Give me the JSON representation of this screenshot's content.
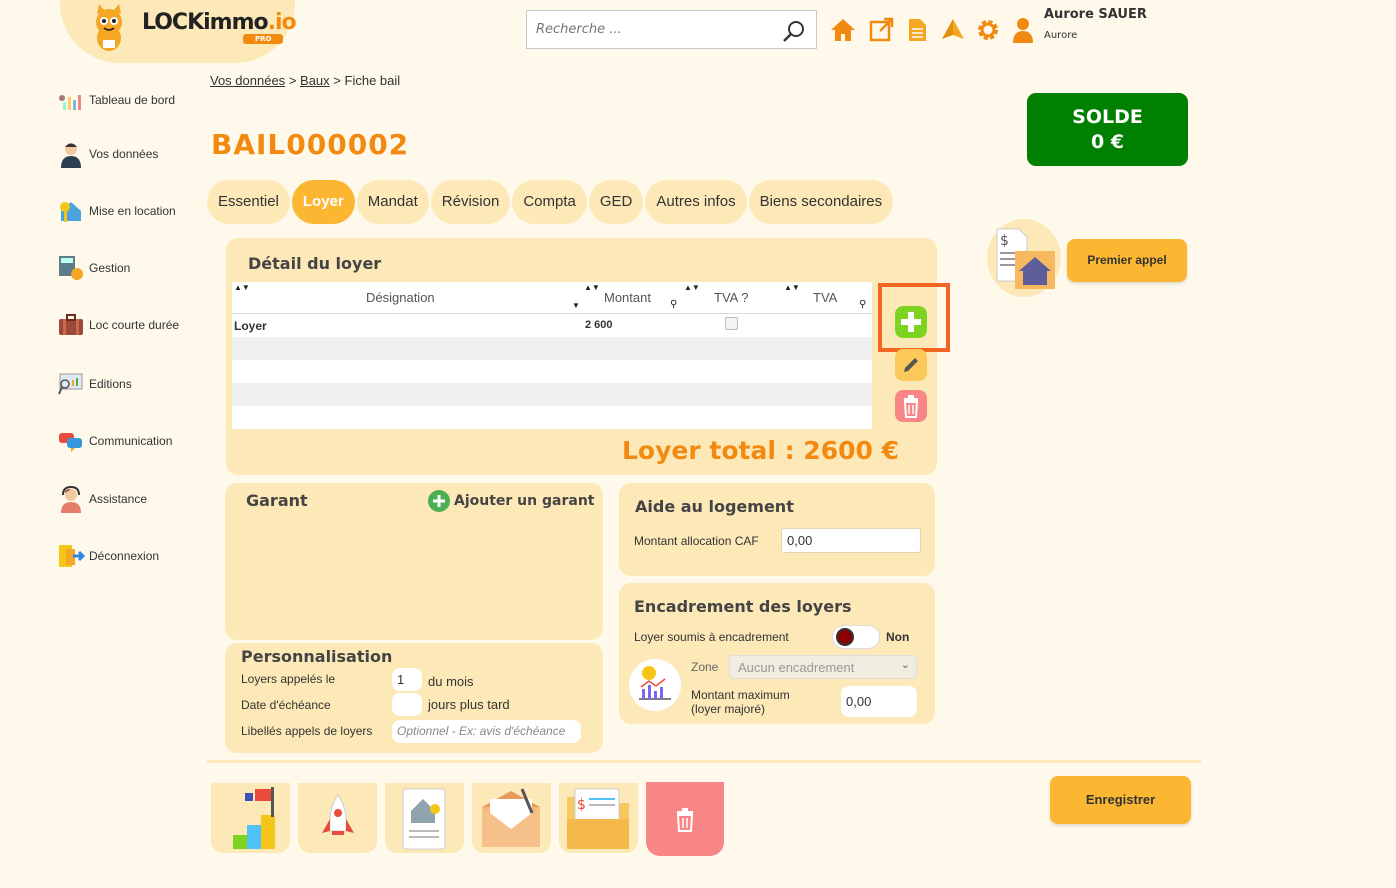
{
  "app": {
    "logo_text": "LOCKimmo",
    "logo_suffix": ".io",
    "logo_badge": "PRO"
  },
  "search": {
    "placeholder": "Recherche ..."
  },
  "header_icons": [
    "home-icon",
    "external-link-icon",
    "document-icon",
    "sailboat-icon",
    "gear-icon",
    "user-icon"
  ],
  "user": {
    "name": "Aurore SAUER",
    "sub": "Aurore"
  },
  "sidebar": {
    "items": [
      {
        "label": "Tableau de bord",
        "icon": "dashboard-icon"
      },
      {
        "label": "Vos données",
        "icon": "person-icon"
      },
      {
        "label": "Mise en location",
        "icon": "house-key-icon"
      },
      {
        "label": "Gestion",
        "icon": "calculator-icon"
      },
      {
        "label": "Loc courte durée",
        "icon": "suitcase-icon"
      },
      {
        "label": "Editions",
        "icon": "chart-board-icon"
      },
      {
        "label": "Communication",
        "icon": "chat-bubbles-icon"
      },
      {
        "label": "Assistance",
        "icon": "headset-icon"
      },
      {
        "label": "Déconnexion",
        "icon": "logout-icon"
      }
    ]
  },
  "breadcrumb": {
    "item1": "Vos données",
    "sep": ">",
    "item2": "Baux",
    "item3": "Fiche bail"
  },
  "page_title": "BAIL000002",
  "solde": {
    "label": "SOLDE",
    "value": "0 €",
    "color": "#008000"
  },
  "tabs": [
    {
      "label": "Essentiel",
      "active": false
    },
    {
      "label": "Loyer",
      "active": true
    },
    {
      "label": "Mandat",
      "active": false
    },
    {
      "label": "Révision",
      "active": false
    },
    {
      "label": "Compta",
      "active": false
    },
    {
      "label": "GED",
      "active": false
    },
    {
      "label": "Autres infos",
      "active": false
    },
    {
      "label": "Biens secondaires",
      "active": false
    }
  ],
  "loyer_detail": {
    "title": "Détail du loyer",
    "columns": [
      "Désignation",
      "Montant",
      "TVA ?",
      "TVA"
    ],
    "rows": [
      {
        "designation": "Loyer",
        "montant": "2 600",
        "tva_checked": false,
        "tva": ""
      }
    ],
    "total": "Loyer total : 2600 €"
  },
  "premier_appel": {
    "label": "Premier appel"
  },
  "garant": {
    "title": "Garant",
    "add_label": "Ajouter un garant"
  },
  "aide": {
    "title": "Aide au logement",
    "caf_label": "Montant allocation CAF",
    "caf_value": "0,00"
  },
  "encadrement": {
    "title": "Encadrement des loyers",
    "soumis_label": "Loyer soumis à encadrement",
    "soumis_value": "Non",
    "zone_label": "Zone",
    "zone_value": "Aucun encadrement",
    "max_label_1": "Montant maximum",
    "max_label_2": "(loyer majoré)",
    "max_value": "0,00"
  },
  "personnalisation": {
    "title": "Personnalisation",
    "appeles_label": "Loyers appelés le",
    "appeles_value": "1",
    "appeles_suffix": "du mois",
    "echeance_label": "Date d'échéance",
    "echeance_value": "",
    "echeance_suffix": "jours plus tard",
    "libelles_label": "Libellés appels de loyers",
    "libelles_placeholder": "Optionnel - Ex: avis d'échéance"
  },
  "save_button": {
    "label": "Enregistrer"
  },
  "bottom_tiles": [
    "flag-steps-icon",
    "rocket-icon",
    "house-document-icon",
    "mail-signature-icon",
    "folder-invoice-icon",
    "trash-icon"
  ]
}
